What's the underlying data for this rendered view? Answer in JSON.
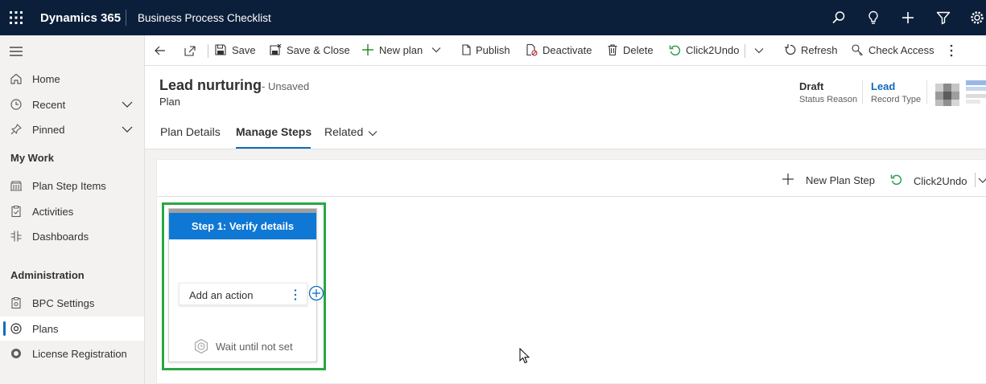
{
  "topbar": {
    "brand": "Dynamics 365",
    "app_name": "Business Process Checklist",
    "icons": [
      "search-icon",
      "lightbulb-icon",
      "plus-icon",
      "filter-icon",
      "settings-icon"
    ]
  },
  "sidenav": {
    "items": [
      {
        "label": "Home",
        "icon": "home-icon"
      },
      {
        "label": "Recent",
        "icon": "clock-icon"
      },
      {
        "label": "Pinned",
        "icon": "pin-icon"
      }
    ],
    "section_my_work": "My Work",
    "my_work_items": [
      {
        "label": "Plan Step Items",
        "icon": "building-icon"
      },
      {
        "label": "Activities",
        "icon": "clipboard-icon"
      },
      {
        "label": "Dashboards",
        "icon": "dashboard-icon"
      }
    ],
    "section_admin": "Administration",
    "admin_items": [
      {
        "label": "BPC Settings",
        "icon": "settings-doc-icon"
      },
      {
        "label": "Plans",
        "icon": "plan-icon",
        "selected": true
      },
      {
        "label": "License Registration",
        "icon": "license-icon"
      }
    ]
  },
  "commandbar": {
    "save": "Save",
    "save_close": "Save & Close",
    "new_plan": "New plan",
    "publish": "Publish",
    "deactivate": "Deactivate",
    "delete": "Delete",
    "click2undo": "Click2Undo",
    "refresh": "Refresh",
    "check_access": "Check Access"
  },
  "header": {
    "title": "Lead nurturing",
    "unsaved": "- Unsaved",
    "entity": "Plan",
    "status_value": "Draft",
    "status_label": "Status Reason",
    "record_type_value": "Lead",
    "record_type_label": "Record Type"
  },
  "tabs": [
    {
      "label": "Plan Details",
      "active": false
    },
    {
      "label": "Manage Steps",
      "active": true
    },
    {
      "label": "Related",
      "active": false
    }
  ],
  "panel": {
    "new_plan_step": "New Plan Step",
    "click2undo": "Click2Undo"
  },
  "step": {
    "title": "Step 1: Verify details",
    "action_placeholder": "Add an action",
    "wait_label": "Wait until not set"
  },
  "colors": {
    "topbar_bg": "#0b1f3a",
    "accent": "#0f6cbd",
    "step_header": "#0f78d4",
    "highlight_outline": "#28a745",
    "undo_green": "#2e9e4f"
  }
}
